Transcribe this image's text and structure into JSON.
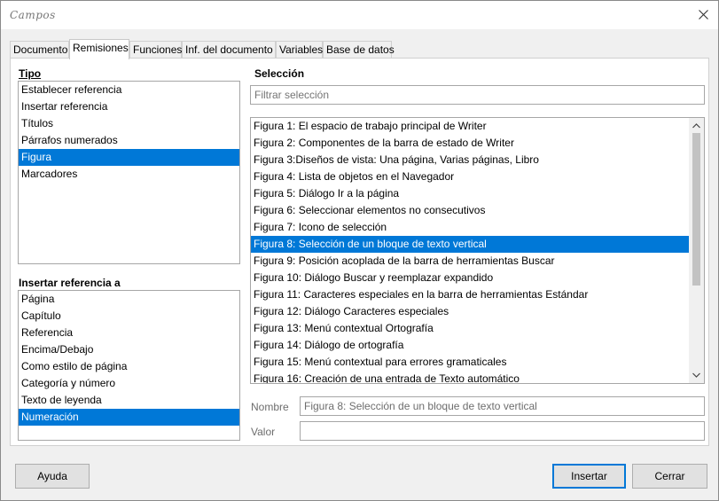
{
  "window": {
    "title": "Campos"
  },
  "tabs": [
    {
      "label": "Documento"
    },
    {
      "label": "Remisiones"
    },
    {
      "label": "Funciones"
    },
    {
      "label": "Inf. del documento"
    },
    {
      "label": "Variables"
    },
    {
      "label": "Base de datos"
    }
  ],
  "tipo": {
    "label": "Tipo",
    "items": [
      "Establecer referencia",
      "Insertar referencia",
      "Títulos",
      "Párrafos numerados",
      "Figura",
      "Marcadores"
    ],
    "selected_index": 4
  },
  "insertar": {
    "label": "Insertar referencia a",
    "items": [
      "Página",
      "Capítulo",
      "Referencia",
      "Encima/Debajo",
      "Como estilo de página",
      "Categoría y número",
      "Texto de leyenda",
      "Numeración"
    ],
    "selected_index": 7
  },
  "seleccion": {
    "label": "Selección",
    "filter_placeholder": "Filtrar selección",
    "items": [
      "Figura 1: El espacio de trabajo principal de Writer",
      "Figura 2: Componentes de la barra de estado de Writer",
      "Figura 3:Diseños de vista: Una página, Varias páginas, Libro",
      "Figura 4: Lista de objetos en el Navegador",
      "Figura 5: Diálogo Ir a la página",
      "Figura 6: Seleccionar elementos no consecutivos",
      "Figura 7: Icono de selección",
      "Figura 8: Selección de un bloque de texto vertical",
      "Figura 9: Posición acoplada de la barra de herramientas Buscar",
      "Figura 10: Diálogo Buscar y reemplazar expandido",
      "Figura 11: Caracteres especiales en la barra de herramientas Estándar",
      "Figura 12: Diálogo Caracteres especiales",
      "Figura 13: Menú contextual Ortografía",
      "Figura 14: Diálogo de ortografía",
      "Figura 15: Menú contextual para errores gramaticales",
      "Figura 16: Creación de una entrada de Texto automático"
    ],
    "selected_index": 7
  },
  "fields": {
    "nombre_label": "Nombre",
    "nombre_value": "Figura 8: Selección de un bloque de texto vertical",
    "valor_label": "Valor",
    "valor_value": ""
  },
  "buttons": {
    "help": "Ayuda",
    "insert": "Insertar",
    "close": "Cerrar"
  },
  "icons": {
    "close": "close-icon",
    "scroll_up": "chevron-up-icon",
    "scroll_down": "chevron-down-icon"
  }
}
